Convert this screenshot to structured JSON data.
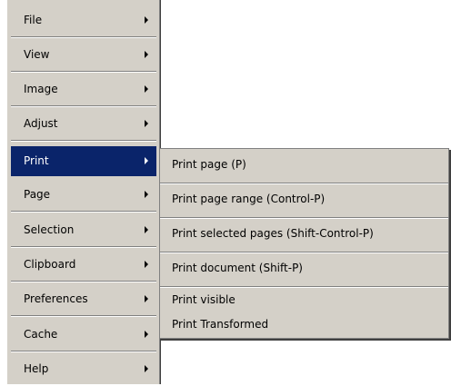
{
  "menu": {
    "items": [
      {
        "label": "File"
      },
      {
        "label": "View"
      },
      {
        "label": "Image"
      },
      {
        "label": "Adjust"
      },
      {
        "label": "Print"
      },
      {
        "label": "Page"
      },
      {
        "label": "Selection"
      },
      {
        "label": "Clipboard"
      },
      {
        "label": "Preferences"
      },
      {
        "label": "Cache"
      },
      {
        "label": "Help"
      }
    ]
  },
  "submenu": {
    "items": [
      {
        "label": "Print page (P)"
      },
      {
        "label": "Print page range (Control-P)"
      },
      {
        "label": "Print selected pages (Shift-Control-P)"
      },
      {
        "label": "Print document (Shift-P)"
      },
      {
        "label": "Print visible"
      },
      {
        "label": "Print Transformed"
      }
    ]
  },
  "colors": {
    "menu_background": "#d4d0c8",
    "highlight": "#0a246a",
    "highlight_text": "#ffffff"
  }
}
